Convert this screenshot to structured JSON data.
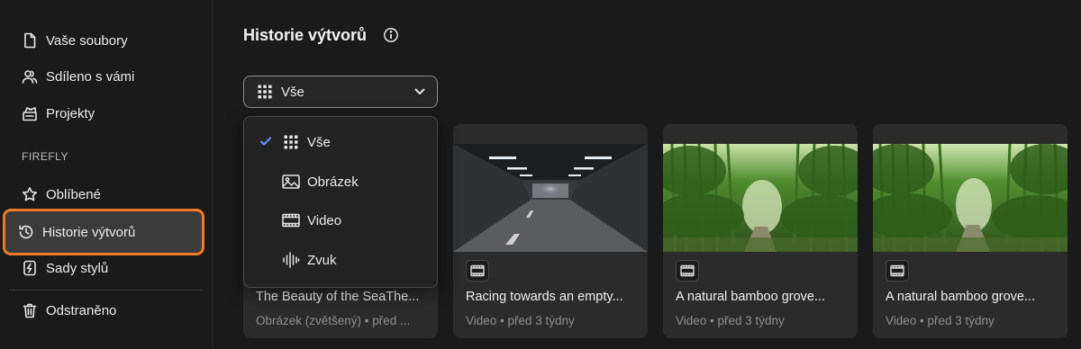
{
  "sidebar": {
    "items": [
      {
        "label": "Vaše soubory",
        "icon": "file-icon"
      },
      {
        "label": "Sdíleno s vámi",
        "icon": "users-icon"
      },
      {
        "label": "Projekty",
        "icon": "projects-icon"
      }
    ],
    "section_label": "FIREFLY",
    "firefly_items": [
      {
        "label": "Oblíbené",
        "icon": "star-icon"
      },
      {
        "label": "Historie výtvorů",
        "icon": "history-icon",
        "active": true
      },
      {
        "label": "Sady stylů",
        "icon": "style-kits-icon"
      }
    ],
    "deleted_label": "Odstraněno",
    "highlight_color": "#f07a2a"
  },
  "header": {
    "title": "Historie výtvorů"
  },
  "filter": {
    "selected": "Vše",
    "options": [
      {
        "label": "Vše",
        "icon": "grid-icon",
        "checked": true
      },
      {
        "label": "Obrázek",
        "icon": "image-icon"
      },
      {
        "label": "Video",
        "icon": "video-icon"
      },
      {
        "label": "Zvuk",
        "icon": "audio-icon"
      }
    ],
    "check_color": "#6b8cff"
  },
  "cards": [
    {
      "title": "The Beauty of the SeaThe...",
      "meta": "Obrázek (zvětšený) • před ..."
    },
    {
      "title": "Racing towards an empty...",
      "meta": "Video • před 3 týdny",
      "thumb": "tunnel"
    },
    {
      "title": "A natural bamboo grove...",
      "meta": "Video • před 3 týdny",
      "thumb": "bamboo"
    },
    {
      "title": "A natural bamboo grove...",
      "meta": "Video • před 3 týdny",
      "thumb": "bamboo"
    }
  ]
}
